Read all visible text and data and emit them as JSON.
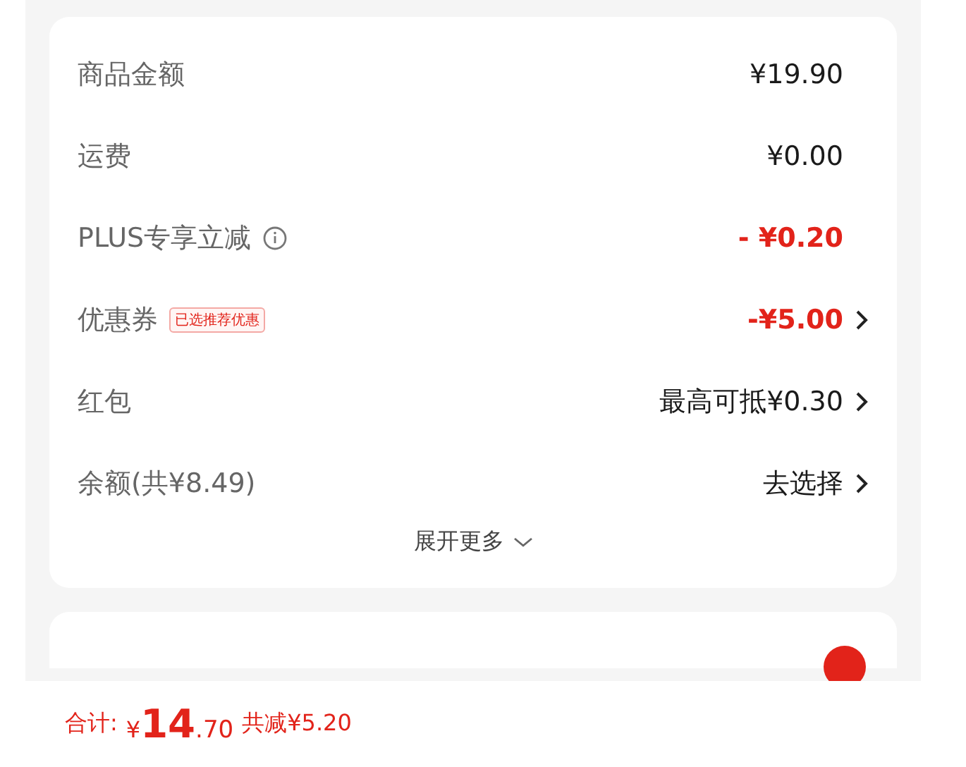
{
  "summary_rows": [
    {
      "label": "商品金额",
      "value": "¥19.90",
      "kind": "plain",
      "arrow": false
    },
    {
      "label": "运费",
      "value": "¥0.00",
      "kind": "plain",
      "arrow": false
    },
    {
      "label": "PLUS专享立减",
      "value": "- ¥0.20",
      "kind": "discount",
      "arrow": false,
      "info": true
    },
    {
      "label": "优惠券",
      "value": "-¥5.00",
      "kind": "discount",
      "arrow": true,
      "tag": "已选推荐优惠"
    },
    {
      "label": "红包",
      "value": "最高可抵¥0.30",
      "kind": "plain",
      "arrow": true
    },
    {
      "label": "余额(共¥8.49)",
      "value": "去选择",
      "kind": "plain",
      "arrow": true
    }
  ],
  "expand": {
    "label": "展开更多"
  },
  "footer": {
    "total_label": "合计:",
    "currency": "¥",
    "total_int": "14",
    "total_dec": ".70",
    "saved": "共减¥5.20"
  }
}
